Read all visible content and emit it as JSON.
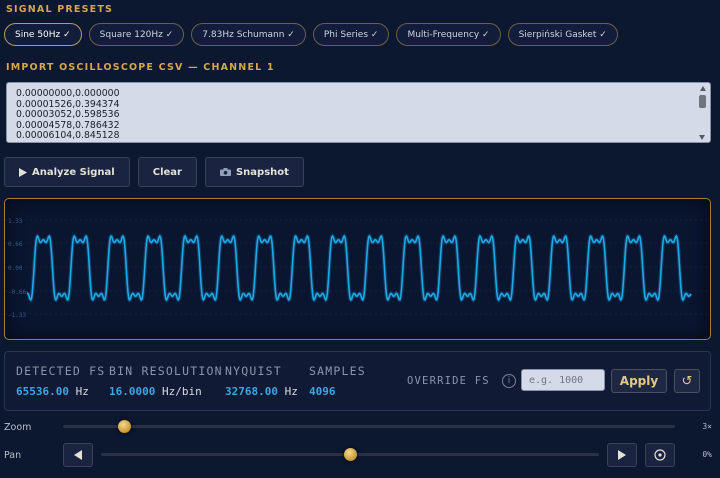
{
  "sections": {
    "presets_title": "SIGNAL PRESETS",
    "import_title": "IMPORT OSCILLOSCOPE CSV — CHANNEL 1"
  },
  "presets": [
    {
      "label": "Sine 50Hz ✓",
      "active": true
    },
    {
      "label": "Square 120Hz ✓",
      "active": false
    },
    {
      "label": "7.83Hz Schumann ✓",
      "active": false
    },
    {
      "label": "Phi Series ✓",
      "active": false
    },
    {
      "label": "Multi-Frequency ✓",
      "active": false
    },
    {
      "label": "Sierpiński Gasket ✓",
      "active": false
    }
  ],
  "csv": {
    "text": "0.00000000,0.000000\n0.00001526,0.394374\n0.00003052,0.598536\n0.00004578,0.786432\n0.00006104,0.845128"
  },
  "actions": {
    "analyze_label": "Analyze Signal",
    "clear_label": "Clear",
    "snapshot_label": "Snapshot"
  },
  "scope": {
    "y_labels": [
      "1.33",
      "0.66",
      "0.00",
      "-0.66",
      "-1.33"
    ],
    "trace_color": "#1ea9e6"
  },
  "chart_data": {
    "type": "line",
    "ylim": [
      -1.33,
      1.33
    ],
    "cycles": 18,
    "samples": 4096,
    "components": [
      {
        "harmonic": 1,
        "amplitude": 0.8
      },
      {
        "harmonic": 3,
        "amplitude": 0.27
      },
      {
        "harmonic": 5,
        "amplitude": 0.12
      }
    ]
  },
  "stats": {
    "fs_label": "DETECTED FS",
    "fs_value": "65536.00",
    "fs_unit": "Hz",
    "bin_label": "BIN RESOLUTION",
    "bin_value": "16.0000",
    "bin_unit": "Hz/bin",
    "nyquist_label": "NYQUIST",
    "nyquist_value": "32768.00",
    "nyquist_unit": "Hz",
    "samples_label": "SAMPLES",
    "samples_value": "4096",
    "override_label": "OVERRIDE FS",
    "info_icon": "i",
    "override_placeholder": "e.g. 1000",
    "apply_label": "Apply",
    "reset_icon": "↺"
  },
  "zoom": {
    "label": "Zoom",
    "value_text": "3×",
    "level": 0.1
  },
  "pan": {
    "label": "Pan",
    "value_text": "0%",
    "level": 0.5
  },
  "colors": {
    "accent": "#d3a74e",
    "value_blue": "#3ea4e2",
    "background": "#0c1730"
  }
}
